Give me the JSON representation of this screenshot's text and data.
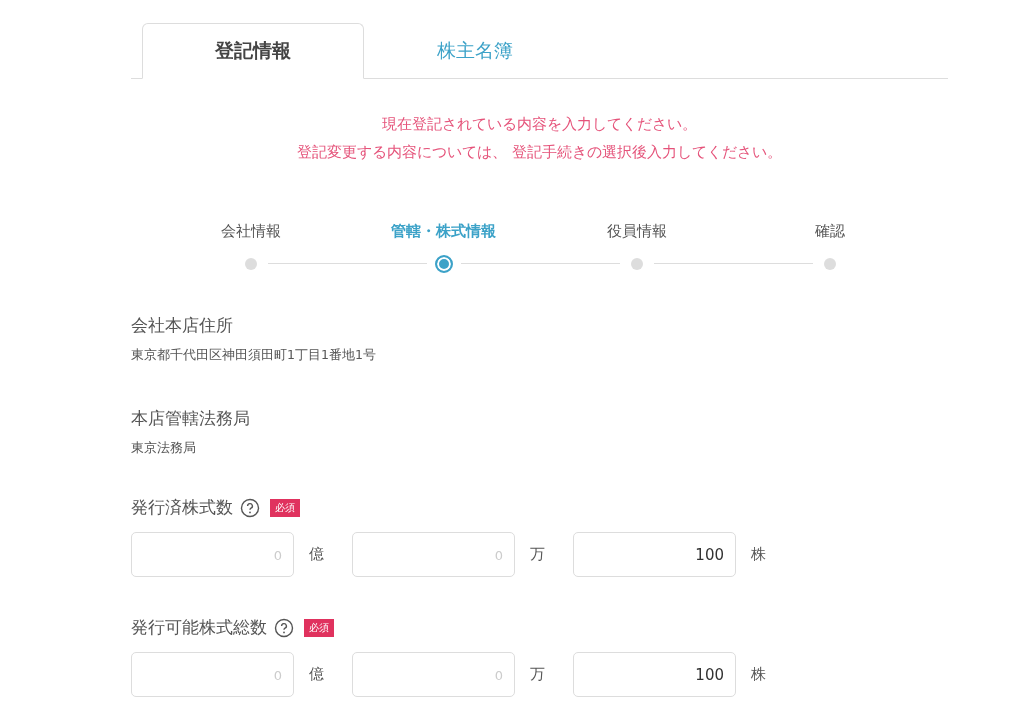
{
  "tabs": [
    {
      "label": "登記情報",
      "selected": true
    },
    {
      "label": "株主名簿",
      "selected": false
    }
  ],
  "notice": [
    "現在登記されている内容を入力してください。",
    "登記変更する内容については、 登記手続きの選択後入力してください。"
  ],
  "steps": [
    {
      "label": "会社情報",
      "selected": false
    },
    {
      "label": "管轄・株式情報",
      "selected": true
    },
    {
      "label": "役員情報",
      "selected": false
    },
    {
      "label": "確認",
      "selected": false
    }
  ],
  "info": [
    {
      "label": "会社本店住所",
      "value": "東京都千代田区神田須田町1丁目1番地1号"
    },
    {
      "label": "本店管轄法務局",
      "value": "東京法務局"
    }
  ],
  "number_fields": [
    {
      "label": "発行済株式数",
      "badge": "必須",
      "inputs": [
        {
          "placeholder": "0",
          "unit": "億"
        },
        {
          "placeholder": "0",
          "unit": "万"
        },
        {
          "value": "100",
          "unit": "株"
        }
      ]
    },
    {
      "label": "発行可能株式総数",
      "badge": "必須",
      "inputs": [
        {
          "placeholder": "0",
          "unit": "億"
        },
        {
          "placeholder": "0",
          "unit": "万"
        },
        {
          "value": "100",
          "unit": "株"
        }
      ]
    }
  ]
}
